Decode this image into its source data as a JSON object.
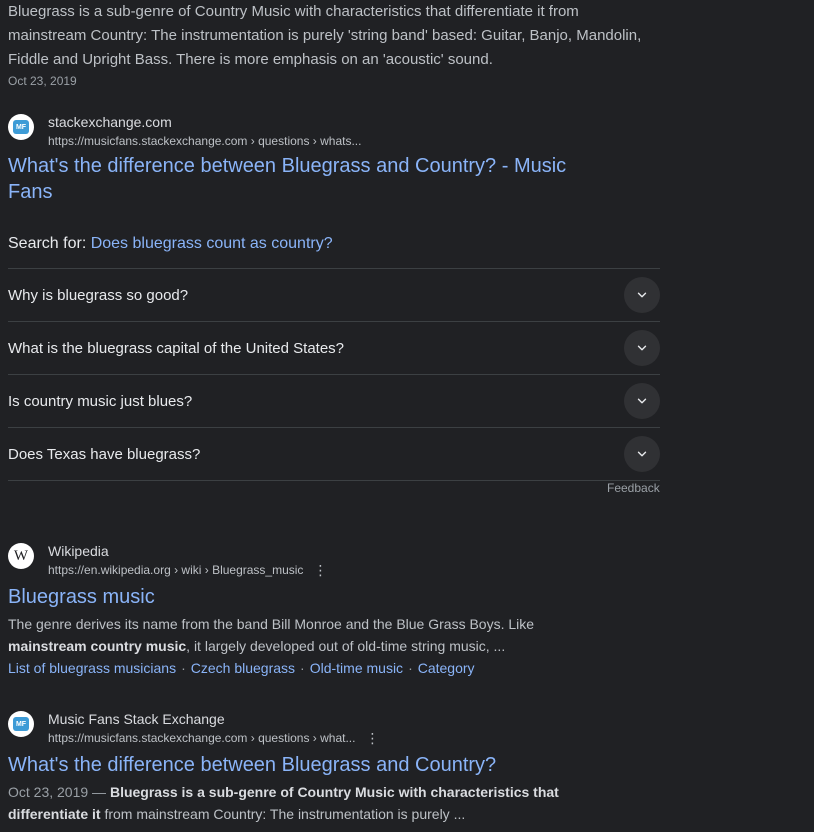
{
  "top_snippet": {
    "text": "Bluegrass is a sub-genre of Country Music with characteristics that differentiate it from mainstream Country: The instrumentation is purely 'string band' based: Guitar, Banjo, Mandolin, Fiddle and Upright Bass. There is more emphasis on an 'acoustic' sound.",
    "date": "Oct 23, 2019"
  },
  "result1": {
    "site_name": "stackexchange.com",
    "url": "https://musicfans.stackexchange.com › questions › whats...",
    "favicon_text": "MF",
    "title_line1": "What's the difference between Bluegrass and Country? - Music",
    "title_line2": "Fans"
  },
  "search_for": {
    "label": "Search for: ",
    "query": "Does bluegrass count as country?"
  },
  "paa": {
    "questions": [
      "Why is bluegrass so good?",
      "What is the bluegrass capital of the United States?",
      "Is country music just blues?",
      "Does Texas have bluegrass?"
    ],
    "feedback": "Feedback"
  },
  "result2": {
    "site_name": "Wikipedia",
    "url": "https://en.wikipedia.org › wiki › Bluegrass_music",
    "favicon_text": "W",
    "title": "Bluegrass music",
    "snippet_part1": "The genre derives its name from the band Bill Monroe and the Blue Grass Boys. Like ",
    "snippet_bold": "mainstream country music",
    "snippet_part2": ", it largely developed out of old-time string music, ...",
    "sitelinks": [
      "List of bluegrass musicians",
      "Czech bluegrass",
      "Old-time music",
      "Category"
    ],
    "sitelink_separator": "·"
  },
  "result3": {
    "site_name": "Music Fans Stack Exchange",
    "url": "https://musicfans.stackexchange.com › questions › what...",
    "favicon_text": "MF",
    "title": "What's the difference between Bluegrass and Country?",
    "date": "Oct 23, 2019 — ",
    "snippet_bold1": "Bluegrass is a sub-genre of Country Music with characteristics that differentiate it",
    "snippet_part": " from mainstream Country: The instrumentation is purely ..."
  },
  "kebab_glyph": "⋮",
  "icons": {
    "chevron": "chevron-down-icon",
    "more": "more-vert-icon"
  },
  "colors": {
    "background": "#202124",
    "link": "#8ab4f8",
    "text": "#bdc1c6",
    "heading": "#e8eaed"
  }
}
